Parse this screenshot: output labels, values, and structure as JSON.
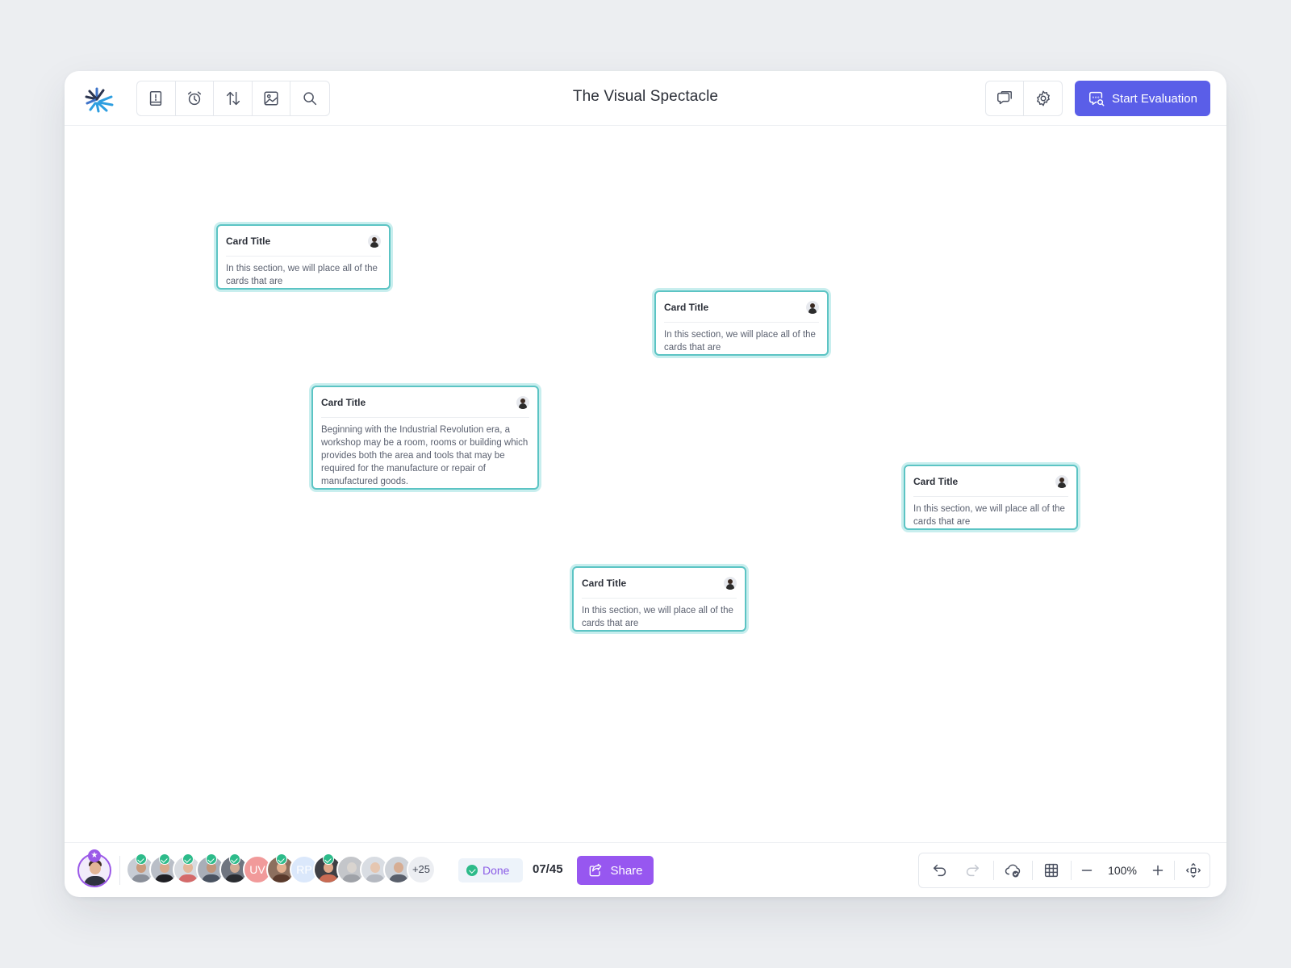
{
  "header": {
    "title": "The Visual Spectacle",
    "logo_icon": "logo-burst-icon",
    "tools": [
      {
        "name": "guide",
        "icon": "book-alert-icon"
      },
      {
        "name": "timer",
        "icon": "alarm-clock-icon"
      },
      {
        "name": "sort",
        "icon": "sort-arrows-icon"
      },
      {
        "name": "image",
        "icon": "image-icon"
      },
      {
        "name": "search",
        "icon": "search-icon"
      }
    ],
    "right_tools": [
      {
        "name": "comments",
        "icon": "chat-bubble-icon"
      },
      {
        "name": "settings",
        "icon": "gear-icon"
      }
    ],
    "start_button": {
      "label": "Start Evaluation",
      "icon": "chat-search-icon"
    },
    "accent_color": "#5a5ee8"
  },
  "cards": [
    {
      "title": "Card Title",
      "body": "In this section, we will place all of the cards that are"
    },
    {
      "title": "Card Title",
      "body": "In this section, we will place all of the cards that are"
    },
    {
      "title": "Card Title",
      "body": "Beginning with the Industrial Revolution era, a workshop may be a room, rooms or building which provides both the area and tools that may be required for the manufacture or repair of manufactured goods."
    },
    {
      "title": "Card Title",
      "body": "In this section, we will place all of the cards that are"
    },
    {
      "title": "Card Title",
      "body": "In this section, we will place all of the cards that are"
    }
  ],
  "card_border_color": "#5cc4c4",
  "footer": {
    "participants": [
      {
        "initials": "",
        "checked": true
      },
      {
        "initials": "",
        "checked": true
      },
      {
        "initials": "",
        "checked": true
      },
      {
        "initials": "",
        "checked": true
      },
      {
        "initials": "",
        "checked": true
      },
      {
        "initials": "UV",
        "checked": false
      },
      {
        "initials": "",
        "checked": true
      },
      {
        "initials": "RP",
        "checked": false
      },
      {
        "initials": "",
        "checked": true
      },
      {
        "initials": "",
        "checked": false
      },
      {
        "initials": "",
        "checked": false
      },
      {
        "initials": "",
        "checked": false
      }
    ],
    "more_count": "+25",
    "status_label": "Done",
    "progress": "07/45",
    "share_label": "Share",
    "share_color": "#9757f0",
    "zoom": "100%"
  }
}
